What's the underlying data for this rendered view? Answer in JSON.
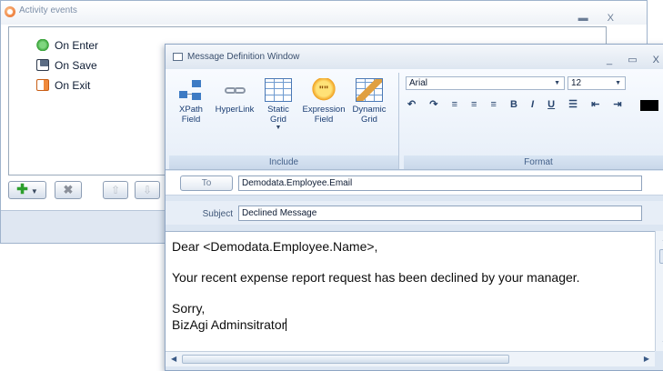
{
  "activity_window": {
    "title": "Activity events",
    "controls": {
      "minimize": "▬",
      "close": "X"
    },
    "events": [
      {
        "label": "On Enter",
        "icon": "enter-icon"
      },
      {
        "label": "On Save",
        "icon": "save-icon"
      },
      {
        "label": "On Exit",
        "icon": "exit-icon"
      }
    ],
    "toolbar": {
      "add": "✚",
      "add_caret": "▼",
      "delete": "✖",
      "up": "⇧",
      "down": "⇩"
    }
  },
  "message_window": {
    "title": "Message Definition Window",
    "controls": {
      "minimize": "_",
      "maximize": "▭",
      "close": "X"
    },
    "ribbon": {
      "include_group": {
        "label": "Include",
        "buttons": [
          {
            "label_line1": "XPath",
            "label_line2": "Field",
            "icon": "xpath-icon"
          },
          {
            "label_line1": "HyperLink",
            "label_line2": "",
            "icon": "hyperlink-icon"
          },
          {
            "label_line1": "Static",
            "label_line2": "Grid",
            "icon": "static-grid-icon",
            "has_caret": true
          },
          {
            "label_line1": "Expression",
            "label_line2": "Field",
            "icon": "expression-icon"
          },
          {
            "label_line1": "Dynamic",
            "label_line2": "Grid",
            "icon": "dynamic-grid-icon"
          }
        ],
        "expression_glyph": "\"\"",
        "caret": "▼"
      },
      "format_group": {
        "label": "Format",
        "font": "Arial",
        "size": "12",
        "dropdown_caret": "▼",
        "tools": [
          "↶",
          "↷",
          "≡",
          "≡",
          "≡",
          "B",
          "I",
          "U",
          "☰",
          "⇤",
          "⇥"
        ],
        "text_color": "#000000"
      }
    },
    "to_button": "To",
    "to_value": "Demodata.Employee.Email",
    "subject_label": "Subject",
    "subject_value": "Declined Message",
    "body_lines": [
      "Dear <Demodata.Employee.Name>,",
      "Your recent expense report request has been declined by your manager.",
      "Sorry,",
      "BizAgi Adminsitrator"
    ],
    "scroll": {
      "up": "▲",
      "down": "▼",
      "left": "◀",
      "right": "▶"
    }
  }
}
